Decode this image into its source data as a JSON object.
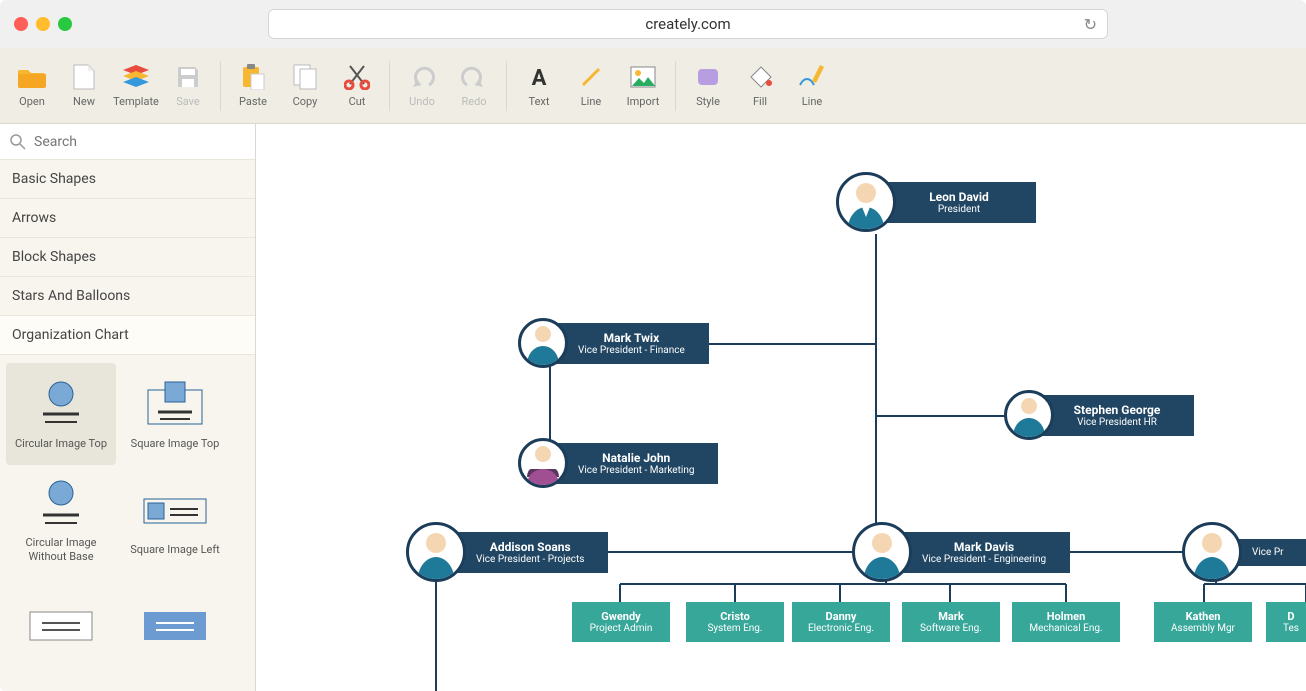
{
  "url": "creately.com",
  "toolbar": {
    "open": "Open",
    "new": "New",
    "template": "Template",
    "save": "Save",
    "paste": "Paste",
    "copy": "Copy",
    "cut": "Cut",
    "undo": "Undo",
    "redo": "Redo",
    "text": "Text",
    "linetool": "Line",
    "import": "Import",
    "style": "Style",
    "fill": "Fill",
    "line": "Line"
  },
  "search": {
    "placeholder": "Search"
  },
  "categories": [
    "Basic Shapes",
    "Arrows",
    "Block Shapes",
    "Stars And Balloons",
    "Organization Chart"
  ],
  "shapes": [
    "Circular Image Top",
    "Square Image Top",
    "Circular Image Without Base",
    "Square Image Left"
  ],
  "org": {
    "n0": {
      "name": "Leon David",
      "role": "President"
    },
    "n1": {
      "name": "Mark Twix",
      "role": "Vice President - Finance"
    },
    "n2": {
      "name": "Stephen George",
      "role": "Vice President HR"
    },
    "n3": {
      "name": "Natalie John",
      "role": "Vice President - Marketing"
    },
    "n4": {
      "name": "Addison Soans",
      "role": "Vice President - Projects"
    },
    "n5": {
      "name": "Mark Davis",
      "role": "Vice President - Engineering"
    },
    "n6": {
      "name": "",
      "role": "Vice Pr"
    },
    "l0": {
      "name": "Gwendy",
      "role": "Project Admin"
    },
    "l1": {
      "name": "Cristo",
      "role": "System Eng."
    },
    "l2": {
      "name": "Danny",
      "role": "Electronic Eng."
    },
    "l3": {
      "name": "Mark",
      "role": "Software Eng."
    },
    "l4": {
      "name": "Holmen",
      "role": "Mechanical Eng."
    },
    "l5": {
      "name": "Kathen",
      "role": "Assembly Mgr"
    },
    "l6": {
      "name": "D",
      "role": "Tes"
    }
  }
}
